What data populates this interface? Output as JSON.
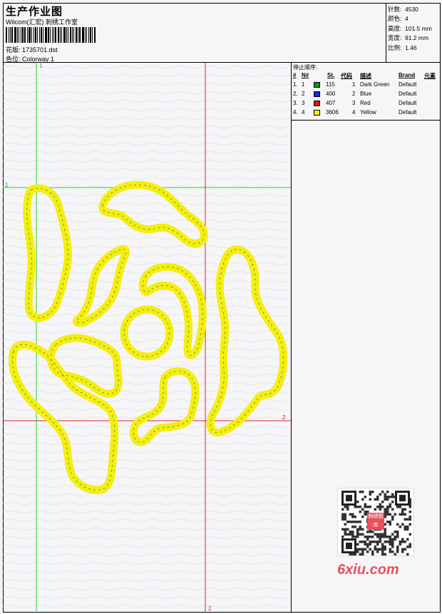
{
  "header": {
    "title": "生产作业图",
    "company": "Wilcom(汇宏) 刺绣工作室",
    "design_file_label": "花版:",
    "design_file": "1735701.dst",
    "colorway_label": "色位:",
    "colorway": "Colorway 1"
  },
  "stats": [
    {
      "label": "针数:",
      "value": "4530"
    },
    {
      "label": "颜色:",
      "value": "4"
    },
    {
      "label": "高度:",
      "value": "101.5 mm"
    },
    {
      "label": "宽度:",
      "value": "91.2 mm"
    },
    {
      "label": "比例:",
      "value": "1.46"
    }
  ],
  "stop_sequence": {
    "title": "停止顺序:",
    "columns": [
      "#",
      "N#",
      "St.",
      "代码",
      "描述",
      "Brand",
      "元素"
    ],
    "rows": [
      {
        "num": "1.",
        "needle": "1",
        "color": "#1a8a2a",
        "stitches": "115",
        "code": "1",
        "desc": "Dark Green",
        "brand": "Default"
      },
      {
        "num": "2.",
        "needle": "2",
        "color": "#1b23d8",
        "stitches": "400",
        "code": "2",
        "desc": "Blue",
        "brand": "Default"
      },
      {
        "num": "3.",
        "needle": "3",
        "color": "#e01616",
        "stitches": "407",
        "code": "3",
        "desc": "Red",
        "brand": "Default"
      },
      {
        "num": "4.",
        "needle": "4",
        "color": "#f4ee10",
        "stitches": "3606",
        "code": "4",
        "desc": "Yellow",
        "brand": "Default"
      }
    ]
  },
  "guides": {
    "green_v_label": "1",
    "green_h_label": "1",
    "red_h_label": "2",
    "red_v_label": "2",
    "green_color": "#22dd22",
    "red_color": "#dd2222"
  },
  "design": {
    "stroke_color": "#f4ee10",
    "detail_color": "#1a6a3a"
  },
  "watermark": {
    "text": "6xiu.com",
    "qr_badge": "刺绣图库"
  }
}
